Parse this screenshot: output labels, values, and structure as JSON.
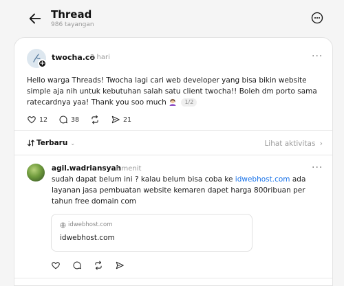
{
  "header": {
    "title": "Thread",
    "views": "986 tayangan"
  },
  "post": {
    "author": "twocha.co",
    "time": "2 hari",
    "text": "Hello warga Threads! Twocha lagi cari web developer yang bisa bikin website simple aja nih untuk kebutuhan salah satu client twocha!! Boleh dm porto sama ratecardnya yaa! Thank you soo much",
    "page_indicator": "1/2",
    "likes": "12",
    "comments": "38",
    "reposts": "",
    "shares": "21"
  },
  "sort": {
    "label": "Terbaru",
    "activity_link": "Lihat aktivitas"
  },
  "reply": {
    "author": "agil.wadriansyah",
    "time": "1 menit",
    "text_before": "sudah dapat belum ini ? kalau belum bisa coba ke ",
    "link_text": "idwebhost.com",
    "text_after": " ada layanan jasa pembuatan website kemaren dapet harga 800ribuan per tahun free domain com",
    "preview": {
      "domain": "idwebhost.com",
      "title": "idwebhost.com"
    }
  },
  "icons": {
    "back": "arrow-left-icon",
    "more": "more-circle-icon",
    "like": "heart-icon",
    "comment": "comment-icon",
    "repost": "repost-icon",
    "share": "send-icon",
    "globe": "globe-icon"
  },
  "colors": {
    "link": "#1a73e8",
    "background": "#f5f5f5",
    "card": "#ffffff"
  }
}
